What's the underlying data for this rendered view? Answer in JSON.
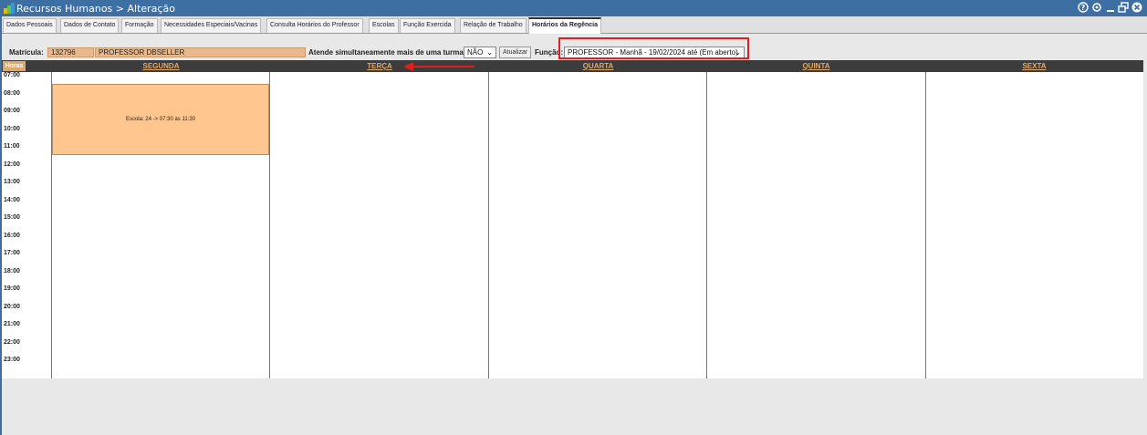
{
  "window": {
    "title": "Recursos Humanos > Alteração"
  },
  "tabs": [
    "Dados Pessoais",
    "Dados de Contato",
    "Formação",
    "Necessidades Especiais/Vacinas",
    "Consulta Horários do Professor",
    "Escolas",
    "Função Exercida",
    "Relação de Trabalho",
    "Horários da Regência"
  ],
  "active_tab": "Horários da Regência",
  "form": {
    "matricula_label": "Matrícula:",
    "matricula_value": "132796",
    "nome_value": "PROFESSOR DBSELLER",
    "atende_label": "Atende simultaneamente mais de uma turma:",
    "atende_value": "NÃO",
    "atualizar_label": "Atualizar",
    "funcao_label": "Função:",
    "funcao_value": "PROFESSOR - Manhã - 19/02/2024 até (Em aberto)"
  },
  "schedule": {
    "horas_label": "Horas",
    "days": [
      "SEGUNDA",
      "TERÇA",
      "QUARTA",
      "QUINTA",
      "SEXTA"
    ],
    "hours": [
      "07:00",
      "08:00",
      "09:00",
      "10:00",
      "11:00",
      "12:00",
      "13:00",
      "14:00",
      "15:00",
      "16:00",
      "17:00",
      "18:00",
      "19:00",
      "20:00",
      "21:00",
      "22:00",
      "23:00"
    ],
    "entries": [
      {
        "day": "SEGUNDA",
        "label": "Escola: 24 -> 07:30 às 11:30"
      }
    ]
  },
  "colors": {
    "titlebar": "#3d6fa3",
    "header_bg": "#3c3c3c",
    "header_text": "#e2a86a",
    "slot_bg": "#ffc68f",
    "highlight_box": "#e02020",
    "annotation_arrow": "#e02020"
  },
  "icons": {
    "logo": "app-logo-icon",
    "help": "help-icon",
    "settings": "gear-icon",
    "minimize": "minimize-icon",
    "restore": "restore-icon",
    "close": "close-icon"
  }
}
